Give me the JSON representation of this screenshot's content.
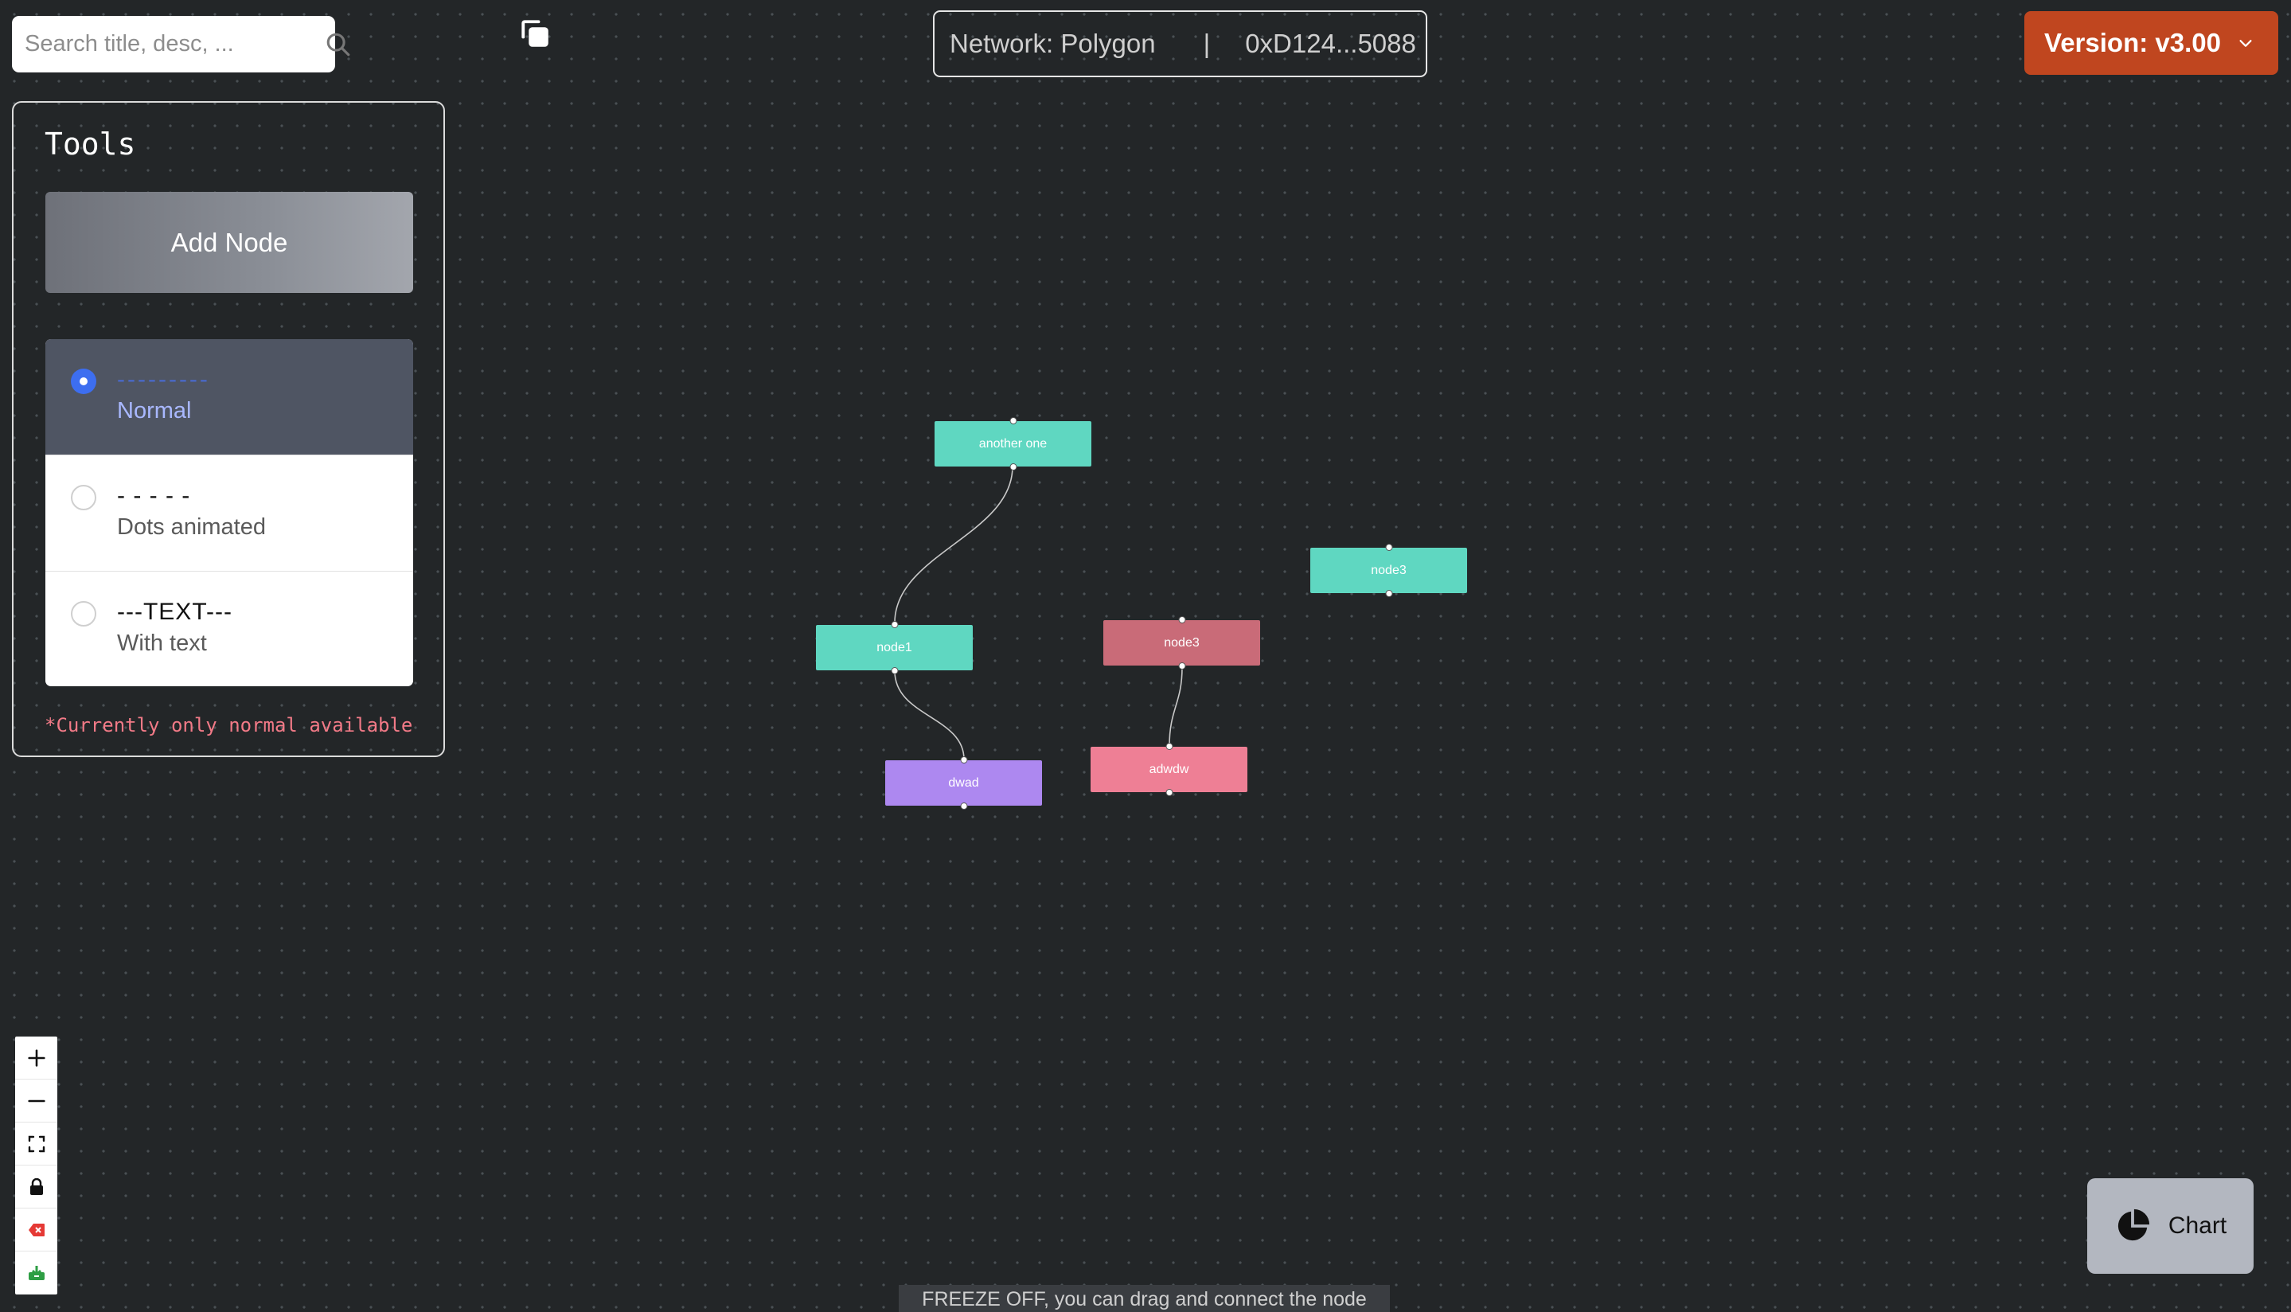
{
  "search": {
    "placeholder": "Search title, desc, ..."
  },
  "network": {
    "label": "Network: Polygon",
    "separator": "|",
    "address": "0xD124...5088"
  },
  "version": {
    "label": "Version: v3.00"
  },
  "tools": {
    "title": "Tools",
    "add_node_label": "Add Node",
    "options": [
      {
        "line": "---------",
        "label": "Normal",
        "selected": true
      },
      {
        "line": "- - - - -",
        "label": "Dots animated",
        "selected": false
      },
      {
        "line": "---TEXT---",
        "label": "With text",
        "selected": false
      }
    ],
    "note": "*Currently only normal available"
  },
  "flow": {
    "nodes": [
      {
        "id": "another-one",
        "label": "another one",
        "color": "#5fd7c1"
      },
      {
        "id": "node1",
        "label": "node1",
        "color": "#5fd7c1"
      },
      {
        "id": "node3-red",
        "label": "node3",
        "color": "#c96b78"
      },
      {
        "id": "node3-teal",
        "label": "node3",
        "color": "#5fd7c1"
      },
      {
        "id": "dwad",
        "label": "dwad",
        "color": "#ad88f0"
      },
      {
        "id": "adwdw",
        "label": "adwdw",
        "color": "#ee7f95"
      }
    ]
  },
  "controls": [
    "zoom-in",
    "zoom-out",
    "fit-view",
    "lock",
    "delete",
    "download"
  ],
  "chart_button": {
    "label": "Chart"
  },
  "status": {
    "text": "FREEZE OFF, you can drag and connect the node"
  },
  "colors": {
    "accent": "#c0461f",
    "selected_radio": "#3d6ef0",
    "note": "#f27a87"
  }
}
